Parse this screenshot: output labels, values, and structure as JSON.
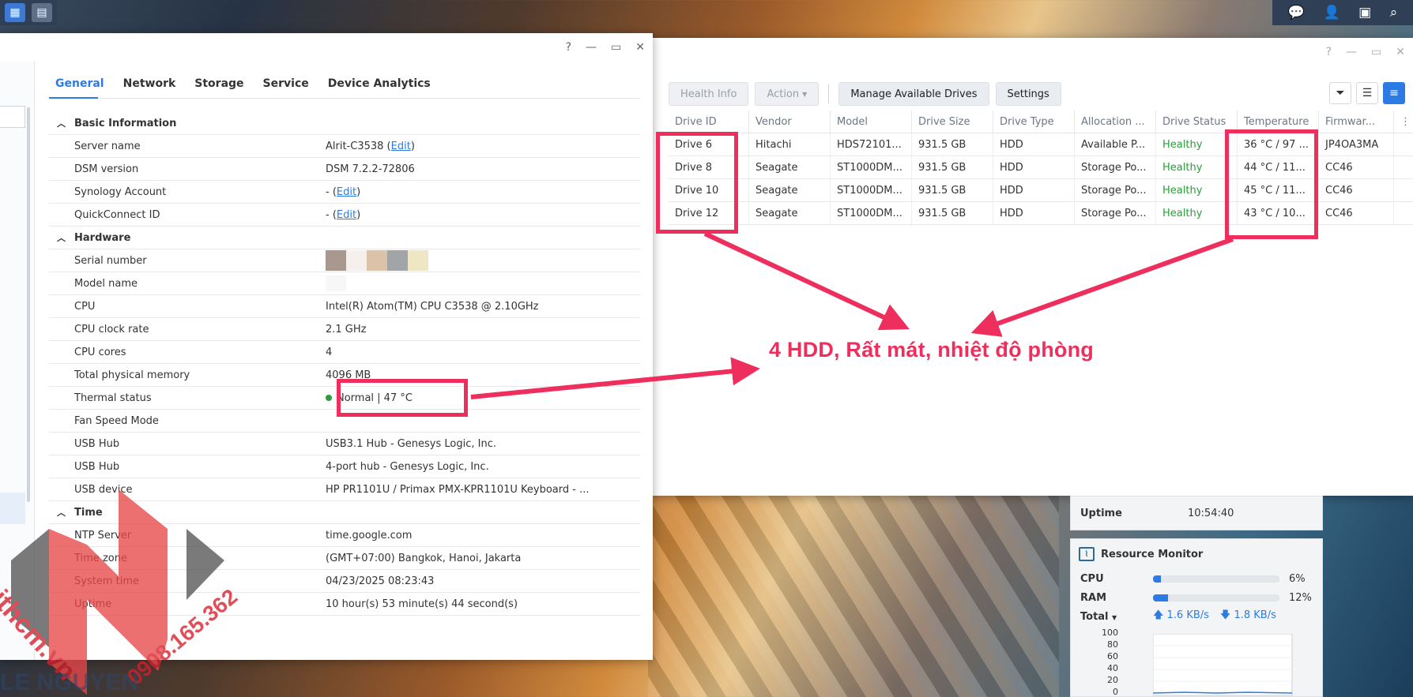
{
  "storage": {
    "buttons": {
      "health_info": "Health Info",
      "action": "Action",
      "manage": "Manage Available Drives",
      "settings": "Settings"
    },
    "columns": [
      "Drive ID",
      "Vendor",
      "Model",
      "Drive Size",
      "Drive Type",
      "Allocation ...",
      "Drive Status",
      "Temperature",
      "Firmwar..."
    ],
    "drives": [
      {
        "id": "Drive 6",
        "vendor": "Hitachi",
        "model": "HDS72101...",
        "size": "931.5 GB",
        "type": "HDD",
        "allocation": "Available P...",
        "status": "Healthy",
        "temp": "36 °C / 97 ...",
        "firmware": "JP4OA3MA"
      },
      {
        "id": "Drive 8",
        "vendor": "Seagate",
        "model": "ST1000DM...",
        "size": "931.5 GB",
        "type": "HDD",
        "allocation": "Storage Po...",
        "status": "Healthy",
        "temp": "44 °C / 11...",
        "firmware": "CC46"
      },
      {
        "id": "Drive 10",
        "vendor": "Seagate",
        "model": "ST1000DM...",
        "size": "931.5 GB",
        "type": "HDD",
        "allocation": "Storage Po...",
        "status": "Healthy",
        "temp": "45 °C / 11...",
        "firmware": "CC46"
      },
      {
        "id": "Drive 12",
        "vendor": "Seagate",
        "model": "ST1000DM...",
        "size": "931.5 GB",
        "type": "HDD",
        "allocation": "Storage Po...",
        "status": "Healthy",
        "temp": "43 °C / 10...",
        "firmware": "CC46"
      }
    ]
  },
  "info": {
    "tabs": [
      "General",
      "Network",
      "Storage",
      "Service",
      "Device Analytics"
    ],
    "sections": {
      "basic": "Basic Information",
      "hardware": "Hardware",
      "time": "Time"
    },
    "edit": "Edit",
    "rows": {
      "server_name": {
        "k": "Server name",
        "v": "Alrit-C3538"
      },
      "dsm": {
        "k": "DSM version",
        "v": "DSM 7.2.2-72806"
      },
      "account": {
        "k": "Synology Account",
        "v": "-"
      },
      "quickconnect": {
        "k": "QuickConnect ID",
        "v": "-"
      },
      "serial": {
        "k": "Serial number"
      },
      "model": {
        "k": "Model name"
      },
      "cpu": {
        "k": "CPU",
        "v": "Intel(R) Atom(TM) CPU C3538 @ 2.10GHz"
      },
      "clock": {
        "k": "CPU clock rate",
        "v": "2.1 GHz"
      },
      "cores": {
        "k": "CPU cores",
        "v": "4"
      },
      "memory": {
        "k": "Total physical memory",
        "v": "4096 MB"
      },
      "thermal": {
        "k": "Thermal status",
        "v": "Normal | 47 °C"
      },
      "fan": {
        "k": "Fan Speed Mode",
        "v": ""
      },
      "usb1": {
        "k": "USB Hub",
        "v": "USB3.1 Hub - Genesys Logic, Inc."
      },
      "usb2": {
        "k": "USB Hub",
        "v": "4-port hub - Genesys Logic, Inc."
      },
      "usbdev": {
        "k": "USB device",
        "v": "HP PR1101U / Primax PMX-KPR1101U Keyboard - ..."
      },
      "ntp": {
        "k": "NTP Server",
        "v": "time.google.com"
      },
      "tz": {
        "k": "Time zone",
        "v": "(GMT+07:00) Bangkok, Hanoi, Jakarta"
      },
      "systime": {
        "k": "System time",
        "v": "04/23/2025 08:23:43"
      },
      "uptime": {
        "k": "Uptime",
        "v": "10 hour(s) 53 minute(s) 44 second(s)"
      }
    }
  },
  "widgets": {
    "uptime": {
      "label": "Uptime",
      "value": "10:54:40"
    },
    "resmon": {
      "title": "Resource Monitor",
      "cpu_label": "CPU",
      "cpu_pct": "6%",
      "cpu": 0.06,
      "ram_label": "RAM",
      "ram_pct": "12%",
      "ram": 0.12,
      "total_label": "Total",
      "up": "1.6 KB/s",
      "down": "1.8 KB/s",
      "axis": [
        "100",
        "80",
        "60",
        "40",
        "20",
        "0"
      ]
    }
  },
  "annotation": "4 HDD, Rất mát, nhiệt độ phòng",
  "watermark": {
    "site": "ithcm.vn",
    "phone": "0908.165.362",
    "name": "LE NGUYEN"
  },
  "colors": {
    "accent": "#2c7be5",
    "healthy": "#2e9c3a",
    "annotation": "#ee2f5e"
  },
  "icons": [
    "notification-icon",
    "user-icon",
    "widget-icon",
    "search-icon",
    "help-icon",
    "minimize-icon",
    "maximize-icon",
    "close-icon",
    "filter-icon",
    "list-view-icon",
    "detail-view-icon"
  ]
}
